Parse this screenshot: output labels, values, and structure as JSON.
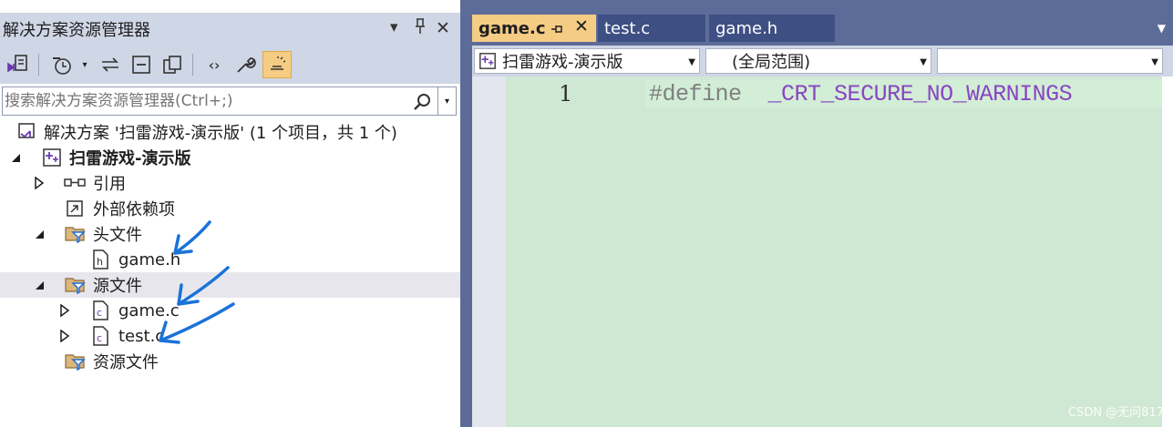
{
  "explorer": {
    "title": "解决方案资源管理器",
    "controls": {
      "dropdown": "▾",
      "pin": "ㅁ",
      "close": "✕"
    },
    "search": {
      "placeholder": "搜索解决方案资源管理器(Ctrl+;)"
    },
    "tree": {
      "solution": "解决方案 '扫雷游戏-演示版' (1 个项目，共 1 个)",
      "project": "扫雷游戏-演示版",
      "references": "引用",
      "external_deps": "外部依赖项",
      "header_files": "头文件",
      "header_file_1": "game.h",
      "source_files": "源文件",
      "source_file_1": "game.c",
      "source_file_2": "test.c",
      "resource_files": "资源文件"
    }
  },
  "editor": {
    "tabs": [
      {
        "label": "game.c",
        "active": true
      },
      {
        "label": "test.c",
        "active": false
      },
      {
        "label": "game.h",
        "active": false
      }
    ],
    "nav": {
      "project": "扫雷游戏-演示版",
      "scope": "(全局范围)",
      "member": ""
    },
    "code": {
      "line_number": "1",
      "keyword": "#define",
      "macro": "_CRT_SECURE_NO_WARNINGS"
    }
  },
  "watermark": "CSDN @无问817",
  "colors": {
    "accent_tab": "#f5cc84",
    "chrome": "#cfd6e5",
    "code_bg": "#cfe8d3",
    "annotation_arrow": "#1a73d9"
  }
}
